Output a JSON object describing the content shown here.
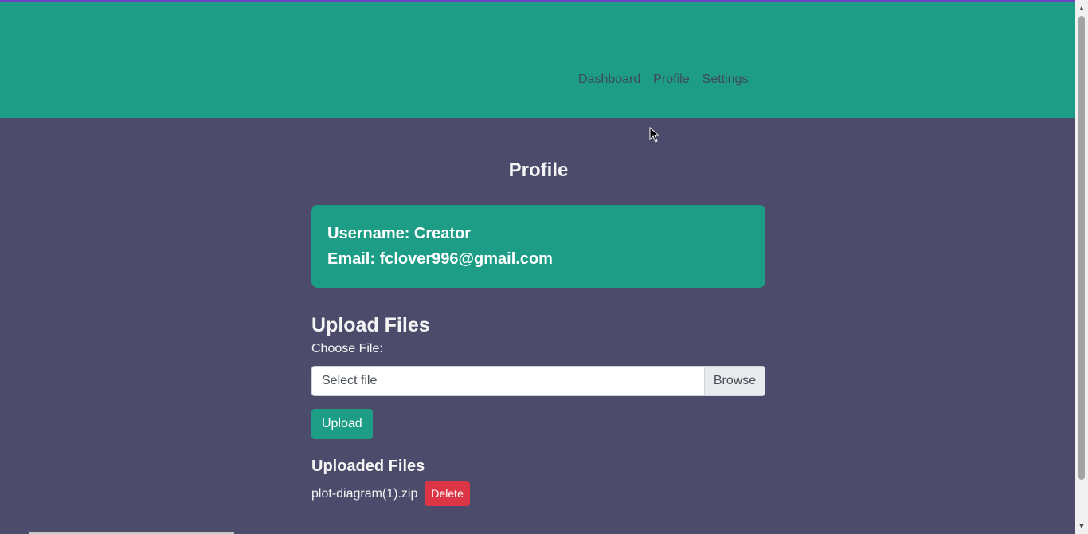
{
  "nav": {
    "links": [
      "Dashboard",
      "Profile",
      "Settings"
    ]
  },
  "page": {
    "title": "Profile"
  },
  "profile": {
    "username_line": "Username: Creator",
    "email_line": "Email: fclover996@gmail.com"
  },
  "upload": {
    "section_title": "Upload Files",
    "choose_label": "Choose File:",
    "file_placeholder": "Select file",
    "browse_label": "Browse",
    "upload_label": "Upload"
  },
  "uploaded": {
    "section_title": "Uploaded Files",
    "files": [
      {
        "name": "plot-diagram(1).zip",
        "delete_label": "Delete"
      }
    ]
  },
  "colors": {
    "navbar": "#1d9d86",
    "background": "#4c4b6b",
    "danger": "#dc3545"
  },
  "icons": {
    "scroll_up": "chevron-up-icon",
    "scroll_down": "chevron-down-icon",
    "cursor": "mouse-pointer-icon"
  }
}
